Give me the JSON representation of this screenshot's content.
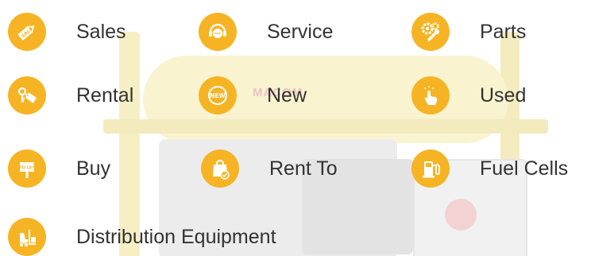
{
  "background": {
    "brand_text": "MACOM"
  },
  "colors": {
    "accent": "#f6b424",
    "text": "#333333"
  },
  "items": [
    {
      "label": "Sales",
      "icon": "sale-tag-icon"
    },
    {
      "label": "Service",
      "icon": "chat-headset-icon"
    },
    {
      "label": "Parts",
      "icon": "gears-wrench-icon"
    },
    {
      "label": "Rental",
      "icon": "keys-tag-icon"
    },
    {
      "label": "New",
      "icon": "new-badge-icon"
    },
    {
      "label": "Used",
      "icon": "pointing-hand-icon"
    },
    {
      "label": "Buy",
      "icon": "sign-post-icon"
    },
    {
      "label": "Rent To",
      "icon": "shopping-bag-check-icon"
    },
    {
      "label": "Fuel Cells",
      "icon": "fuel-pump-icon"
    },
    {
      "label": "Distribution Equipment",
      "icon": "forklift-icon"
    }
  ]
}
